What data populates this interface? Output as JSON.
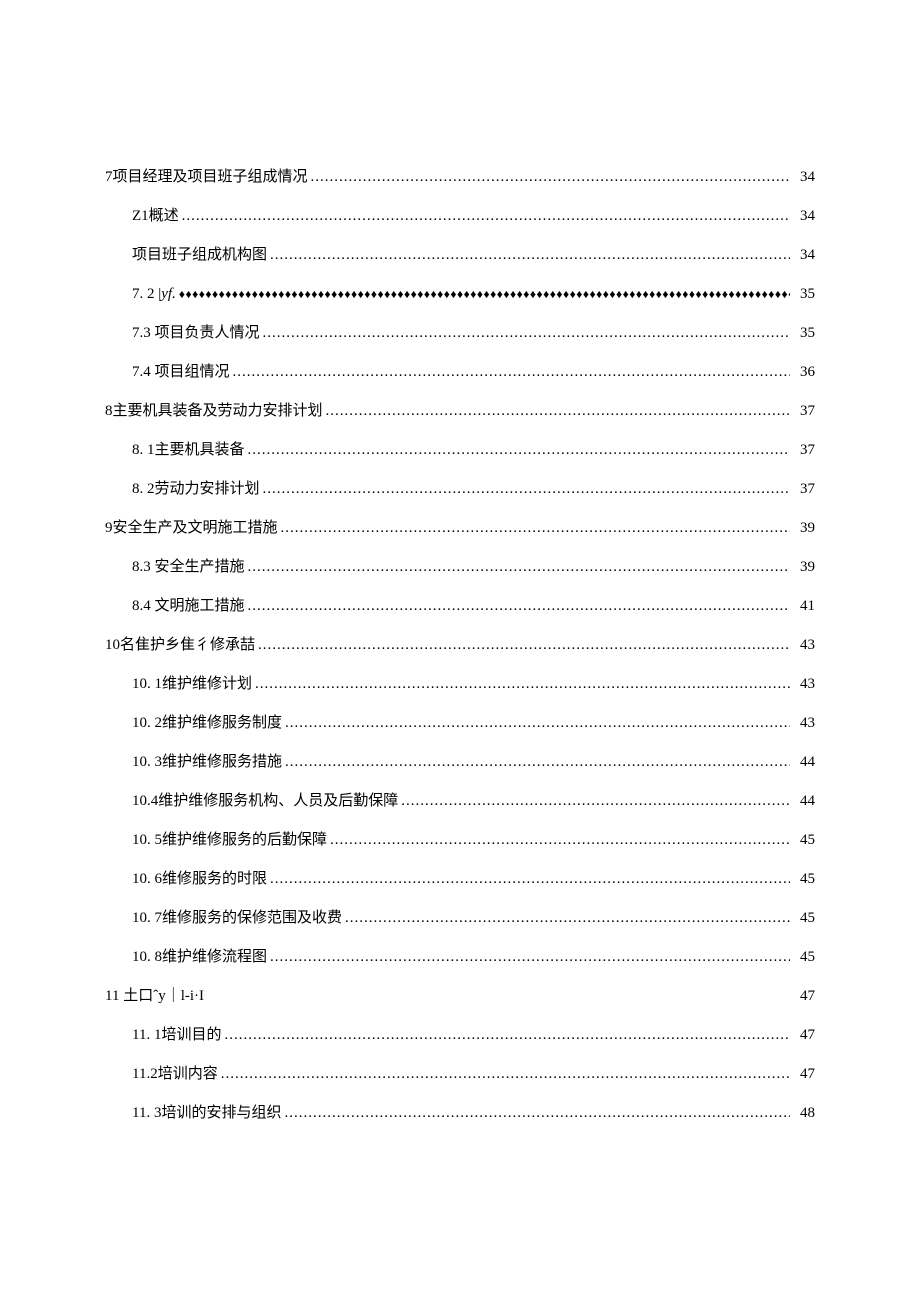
{
  "toc": [
    {
      "level": 1,
      "label": "7项目经理及项目班子组成情况",
      "page": "34",
      "leader": "dots"
    },
    {
      "level": 2,
      "label": "Z1概述",
      "page": "34",
      "leader": "dots"
    },
    {
      "level": 2,
      "label": "项目班子组成机构图",
      "page": "34",
      "leader": "dots"
    },
    {
      "level": 2,
      "label": "7. 2 |yf.",
      "page": "35",
      "leader": "diamonds",
      "italic_suffix": true
    },
    {
      "level": 2,
      "label": "7.3  项目负责人情况",
      "page": "35",
      "leader": "dots"
    },
    {
      "level": 2,
      "label": "7.4  项目组情况",
      "page": "36",
      "leader": "dots"
    },
    {
      "level": 1,
      "label": "8主要机具装备及劳动力安排计划",
      "page": "37",
      "leader": "dots"
    },
    {
      "level": 2,
      "label": "8. 1主要机具装备",
      "page": "37",
      "leader": "dots"
    },
    {
      "level": 2,
      "label": "8. 2劳动力安排计划",
      "page": "37",
      "leader": "dots"
    },
    {
      "level": 1,
      "label": "9安全生产及文明施工措施",
      "page": "39",
      "leader": "dots"
    },
    {
      "level": 2,
      "label": "8.3  安全生产措施",
      "page": "39",
      "leader": "dots"
    },
    {
      "level": 2,
      "label": "8.4  文明施工措施",
      "page": "41",
      "leader": "dots"
    },
    {
      "level": 1,
      "label": "10名隹护乡隹彳修承喆",
      "page": "43",
      "leader": "dots"
    },
    {
      "level": 2,
      "label": "10. 1维护维修计划",
      "page": "43",
      "leader": "dots"
    },
    {
      "level": 2,
      "label": "10. 2维护维修服务制度",
      "page": "43",
      "leader": "dots"
    },
    {
      "level": 2,
      "label": "10. 3维护维修服务措施",
      "page": "44",
      "leader": "dots"
    },
    {
      "level": 2,
      "label": "10.4维护维修服务机构、人员及后勤保障",
      "page": "44",
      "leader": "dots"
    },
    {
      "level": 2,
      "label": "10. 5维护维修服务的后勤保障",
      "page": "45",
      "leader": "dots"
    },
    {
      "level": 2,
      "label": "10. 6维修服务的时限",
      "page": "45",
      "leader": "dots"
    },
    {
      "level": 2,
      "label": "10. 7维修服务的保修范围及收费",
      "page": "45",
      "leader": "dots"
    },
    {
      "level": 2,
      "label": "10. 8维护维修流程图",
      "page": "45",
      "leader": "dots"
    },
    {
      "level": 1,
      "label": "11 土口ˆy｜l-i·I",
      "page": "47",
      "leader": "none"
    },
    {
      "level": 2,
      "label": "11. 1培训目的",
      "page": "47",
      "leader": "dots"
    },
    {
      "level": 2,
      "label": "11.2培训内容",
      "page": "47",
      "leader": "dots"
    },
    {
      "level": 2,
      "label": "11. 3培训的安排与组织",
      "page": "48",
      "leader": "dots"
    }
  ]
}
